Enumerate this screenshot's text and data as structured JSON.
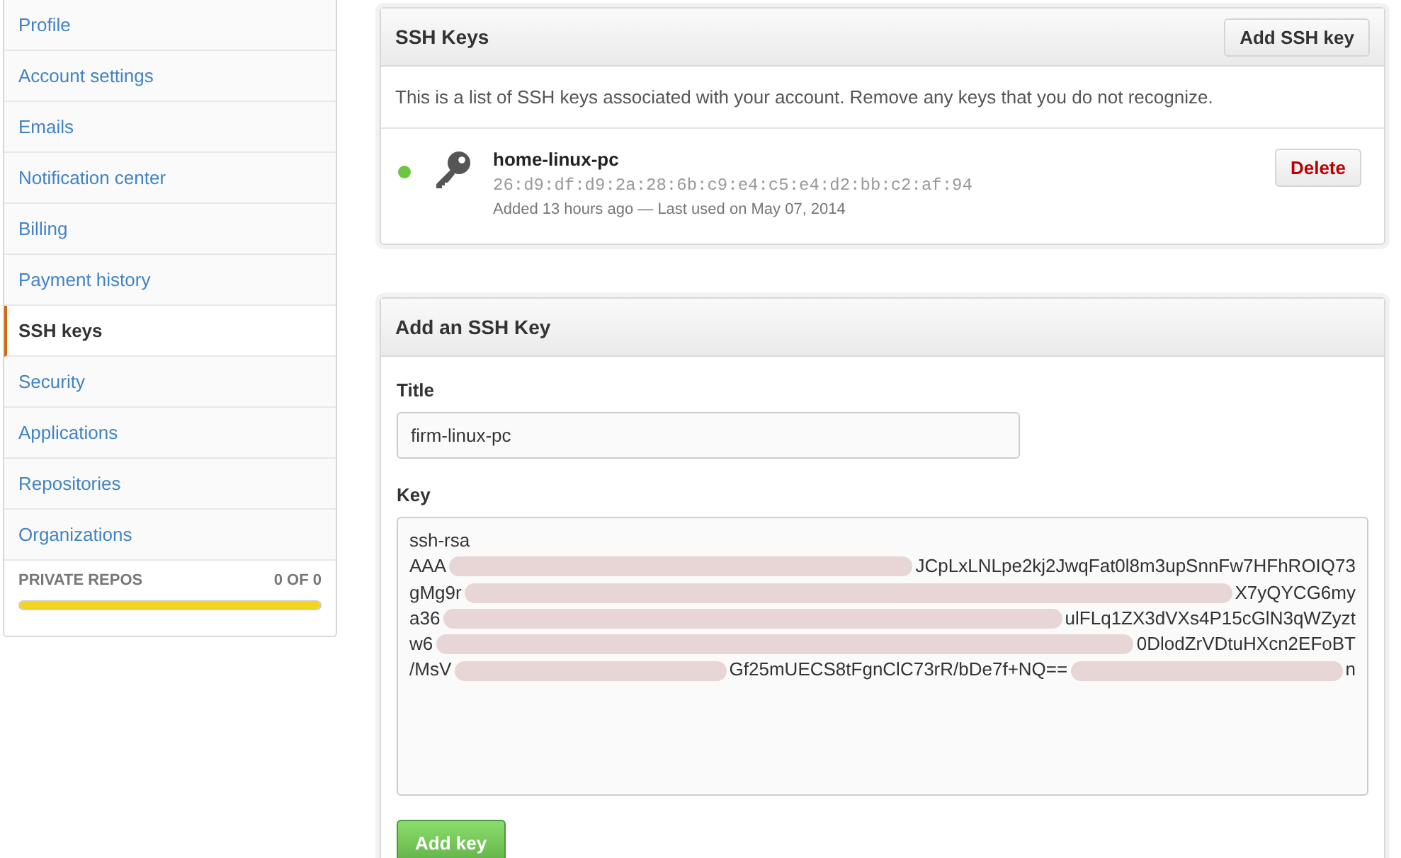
{
  "sidebar": {
    "items": [
      {
        "label": "Profile",
        "selected": false
      },
      {
        "label": "Account settings",
        "selected": false
      },
      {
        "label": "Emails",
        "selected": false
      },
      {
        "label": "Notification center",
        "selected": false
      },
      {
        "label": "Billing",
        "selected": false
      },
      {
        "label": "Payment history",
        "selected": false
      },
      {
        "label": "SSH keys",
        "selected": true
      },
      {
        "label": "Security",
        "selected": false
      },
      {
        "label": "Applications",
        "selected": false
      },
      {
        "label": "Repositories",
        "selected": false
      },
      {
        "label": "Organizations",
        "selected": false
      }
    ],
    "private_repos": {
      "label": "PRIVATE REPOS",
      "count": "0 OF 0",
      "level": 1
    }
  },
  "ssh_keys": {
    "title": "SSH Keys",
    "add_button": "Add SSH key",
    "description": "This is a list of SSH keys associated with your account. Remove any keys that you do not recognize.",
    "keys": [
      {
        "name": "home-linux-pc",
        "fingerprint": "26:d9:df:d9:2a:28:6b:c9:e4:c5:e4:d2:bb:c2:af:94",
        "meta": "Added 13 hours ago — Last used on May 07, 2014",
        "active": true,
        "delete_button": "Delete"
      }
    ]
  },
  "add_form": {
    "title": "Add an SSH Key",
    "title_label": "Title",
    "title_value": "firm-linux-pc",
    "key_label": "Key",
    "key_lines": [
      [
        {
          "kind": "text",
          "text": "ssh-rsa"
        }
      ],
      [
        {
          "kind": "text",
          "text": "AAA"
        },
        {
          "kind": "redacted"
        },
        {
          "kind": "text",
          "text": "JCpLxLNLpe2kj2JwqFat0l8m3upSnnFw7HFhROIQ73"
        }
      ],
      [
        {
          "kind": "text",
          "text": "gMg9r"
        },
        {
          "kind": "redacted"
        },
        {
          "kind": "text",
          "text": "X7yQYCG6my"
        }
      ],
      [
        {
          "kind": "text",
          "text": "a36"
        },
        {
          "kind": "redacted"
        },
        {
          "kind": "text",
          "text": "ulFLq1ZX3dVXs4P15cGlN3qWZyzt"
        }
      ],
      [
        {
          "kind": "text",
          "text": "w6"
        },
        {
          "kind": "redacted"
        },
        {
          "kind": "text",
          "text": "0DlodZrVDtuHXcn2EFoBT"
        }
      ],
      [
        {
          "kind": "text",
          "text": "/MsV"
        },
        {
          "kind": "redacted"
        },
        {
          "kind": "text",
          "text": "Gf25mUECS8tFgnClC73rR/bDe7f+NQ=="
        },
        {
          "kind": "redacted"
        },
        {
          "kind": "text",
          "text": "n"
        }
      ]
    ],
    "submit_button": "Add key"
  }
}
